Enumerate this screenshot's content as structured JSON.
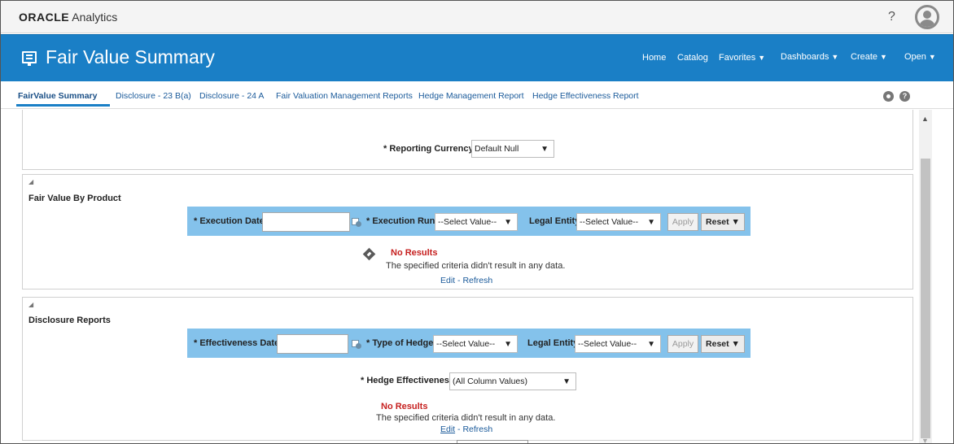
{
  "app": {
    "brand_oracle": "ORACLE",
    "brand_analytics": "Analytics",
    "help_symbol": "?"
  },
  "header": {
    "title": "Fair Value Summary",
    "nav": {
      "home": "Home",
      "catalog": "Catalog",
      "favorites": "Favorites",
      "dashboards": "Dashboards",
      "create": "Create",
      "open": "Open"
    },
    "caret": "▼"
  },
  "tabs": [
    {
      "label": "FairValue Summary"
    },
    {
      "label": "Disclosure - 23 B(a)"
    },
    {
      "label": "Disclosure - 24 A"
    },
    {
      "label": "Fair Valuation Management Reports"
    },
    {
      "label": "Hedge Management Report"
    },
    {
      "label": "Hedge Effectiveness Report"
    }
  ],
  "tab_icons": {
    "help": "?"
  },
  "reporting": {
    "label": "* Reporting Currency",
    "value": "Default Null"
  },
  "fair_value_by_product": {
    "title": "Fair Value By Product",
    "execution_date_label": "* Execution Date",
    "execution_run_label": "* Execution Run",
    "execution_run_value": "--Select Value--",
    "legal_entity_label": "Legal Entity",
    "legal_entity_value": "--Select Value--",
    "apply": "Apply",
    "reset": "Reset ▼",
    "no_results": "No Results",
    "message": "The specified criteria didn't result in any data.",
    "edit": "Edit",
    "separator": " - ",
    "refresh": "Refresh"
  },
  "disclosure_reports": {
    "title": "Disclosure Reports",
    "effectiveness_date_label": "* Effectiveness Date",
    "type_of_hedge_label": "* Type of Hedge",
    "type_of_hedge_value": "--Select Value--",
    "legal_entity_label": "Legal Entity",
    "legal_entity_value": "--Select Value--",
    "apply": "Apply",
    "reset": "Reset ▼",
    "hedge_effectiveness_label": "* Hedge Effectiveness",
    "hedge_effectiveness_value": "(All Column Values)",
    "no_results": "No Results",
    "message": "The specified criteria didn't result in any data.",
    "edit": "Edit",
    "separator": " - ",
    "refresh": "Refresh"
  },
  "glyphs": {
    "dropdown_arrow": "▼",
    "collapse": "◢",
    "scroll_up": "▲",
    "scroll_down": "▼"
  },
  "colors": {
    "brand_blue": "#1a7fc6",
    "filter_bar": "#84c2eb",
    "error_red": "#c6201f",
    "link_blue": "#1a5a9a"
  }
}
